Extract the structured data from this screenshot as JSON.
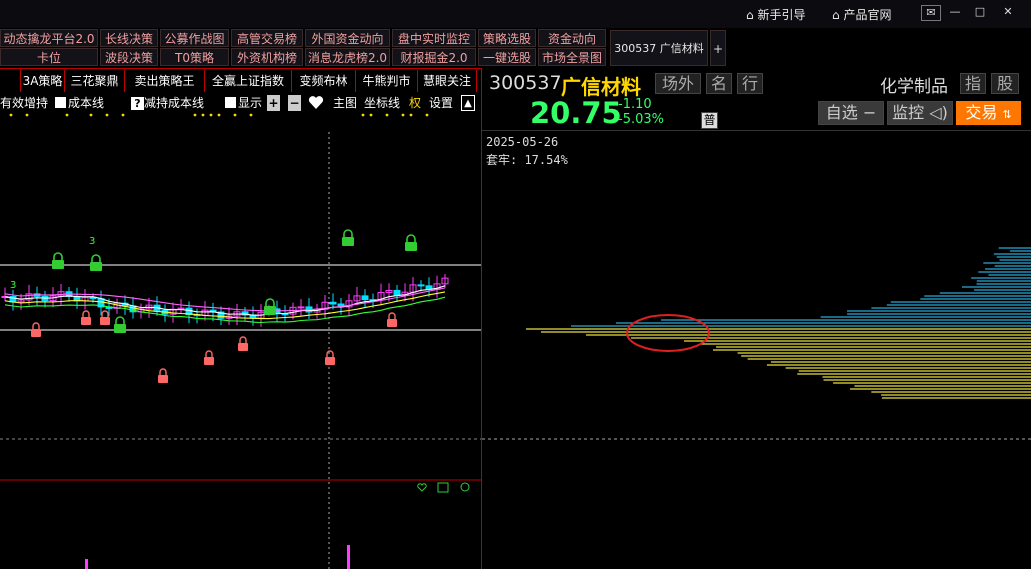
{
  "toolbar_row1": [
    "动态擒龙平台2.0",
    "长线决策",
    "公募作战图",
    "高管交易榜",
    "外国资金动向",
    "盘中实时监控",
    "策略选股",
    "资金动向"
  ],
  "toolbar_row2": [
    "卡位",
    "波段决策",
    "T0策略",
    "外资机构榜",
    "消息龙虎榜2.0",
    "财报掘金2.0",
    "一键选股",
    "市场全景图"
  ],
  "tab_stock": "300537 广信材料",
  "tab_plus": "+",
  "top_links": {
    "newbie": "新手引导",
    "website": "产品官网"
  },
  "window_buttons": [
    "✉",
    "—",
    "□",
    "✕"
  ],
  "strategy_tabs": [
    "3A策略",
    "三花聚鼎",
    "卖出策略王",
    "全赢上证指数",
    "变频布林",
    "牛熊判市",
    "慧眼关注"
  ],
  "options": {
    "effective_increase": "有效增持",
    "cost_line": "成本线",
    "help": "?",
    "reduce_cost_line": "减持成本线",
    "show": "显示",
    "plus": "+",
    "minus": "−",
    "main_chart": "主图",
    "coord_line": "坐标线",
    "right": "权",
    "settings": "设置",
    "up": "▲"
  },
  "stock": {
    "code": "300537",
    "name": "广信材料",
    "tags": [
      "场外",
      "名",
      "行"
    ],
    "industry": "化学制品",
    "ind_tags": [
      "指",
      "股"
    ],
    "price": "20.75",
    "change": "-1.10",
    "change_pct": "-5.03%",
    "type_badge": "普",
    "buttons": {
      "watch": "自选",
      "watch_sym": "−",
      "monitor": "监控",
      "trade": "交易"
    }
  },
  "chip_info": {
    "date": "2025-05-26",
    "trapped": "套牢: 17.54%"
  },
  "kline": {
    "markers": [
      "3",
      "3"
    ]
  },
  "colors": {
    "rise": "#ff3cff",
    "fall": "#00e0ff",
    "ma1": "#ffffff",
    "ma2": "#ffff33",
    "ma3": "#33ff33",
    "ma4": "#ff66ff",
    "chip_yellow": "#e8e040",
    "chip_blue": "#2aa8d8",
    "price_green": "#33ff66",
    "accent_orange": "#ff7700"
  }
}
